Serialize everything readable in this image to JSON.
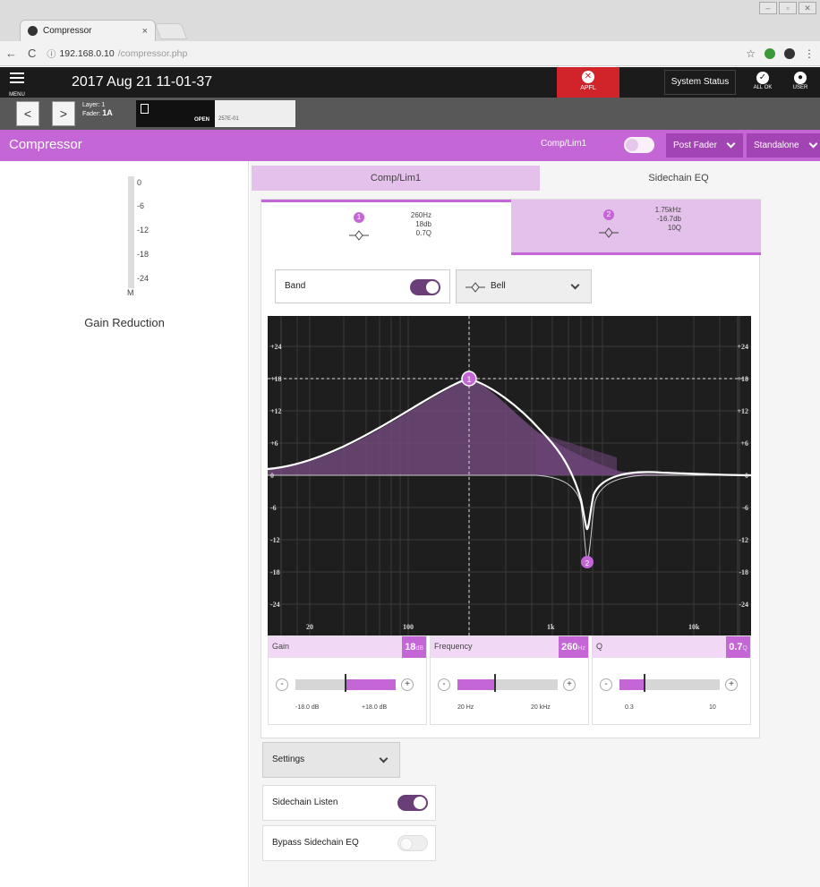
{
  "browser": {
    "tab_title": "Compressor",
    "tab_close": "×",
    "url_host": "192.168.0.10",
    "url_path": "/compressor.php",
    "window_controls": [
      "–",
      "▫",
      "✕"
    ]
  },
  "header": {
    "menu_label": "MENU",
    "datetime": "2017 Aug 21 11-01-37",
    "apfl_label": "APFL",
    "system_status": "System Status",
    "all_ok": "ALL OK",
    "user": "USER"
  },
  "layer": {
    "prev": "<",
    "next": ">",
    "layer_label": "Layer: 1",
    "fader_prefix": "Fader:",
    "fader_value": "1A",
    "open_label": "OPEN",
    "code": "257E-01"
  },
  "compressor_bar": {
    "title": "Compressor",
    "comp_lim_label": "Comp/Lim1",
    "post_fader": "Post Fader",
    "standalone": "Standalone"
  },
  "gain_reduction": {
    "scale": [
      "0",
      "-6",
      "-12",
      "-18",
      "-24"
    ],
    "bottom": "M",
    "label": "Gain Reduction"
  },
  "tabs": {
    "comp_lim": "Comp/Lim1",
    "sidechain_eq": "Sidechain EQ"
  },
  "bands": [
    {
      "num": "1",
      "freq": "260Hz",
      "gain": "18db",
      "q": "0.7Q"
    },
    {
      "num": "2",
      "freq": "1.75kHz",
      "gain": "-16.7db",
      "q": "10Q"
    }
  ],
  "band_control": {
    "band_label": "Band",
    "filter_type": "Bell"
  },
  "graph": {
    "y_labels": [
      "+24",
      "+18",
      "+12",
      "+6",
      "0",
      "-6",
      "-12",
      "-18",
      "-24"
    ],
    "x_labels": [
      "20",
      "100",
      "1k",
      "10k"
    ],
    "markers": [
      "1",
      "2"
    ]
  },
  "params": {
    "gain": {
      "label": "Gain",
      "value": "18",
      "unit": "dB",
      "min": "-18.0 dB",
      "max": "+18.0 dB"
    },
    "frequency": {
      "label": "Frequency",
      "value": "260",
      "unit": "Hz",
      "min": "20 Hz",
      "max": "20 kHz"
    },
    "q": {
      "label": "Q",
      "value": "0.7",
      "unit": "Q",
      "min": "0.3",
      "max": "10"
    },
    "minus": "-",
    "plus": "+"
  },
  "settings": {
    "label": "Settings",
    "sidechain_listen": "Sidechain Listen",
    "bypass_sidechain_eq": "Bypass Sidechain EQ"
  },
  "colors": {
    "accent": "#c566d6",
    "accent_dark": "#a244b3",
    "accent_light": "#e4c1ea",
    "toggle_on": "#6a3f78",
    "alert": "#d0232a"
  }
}
